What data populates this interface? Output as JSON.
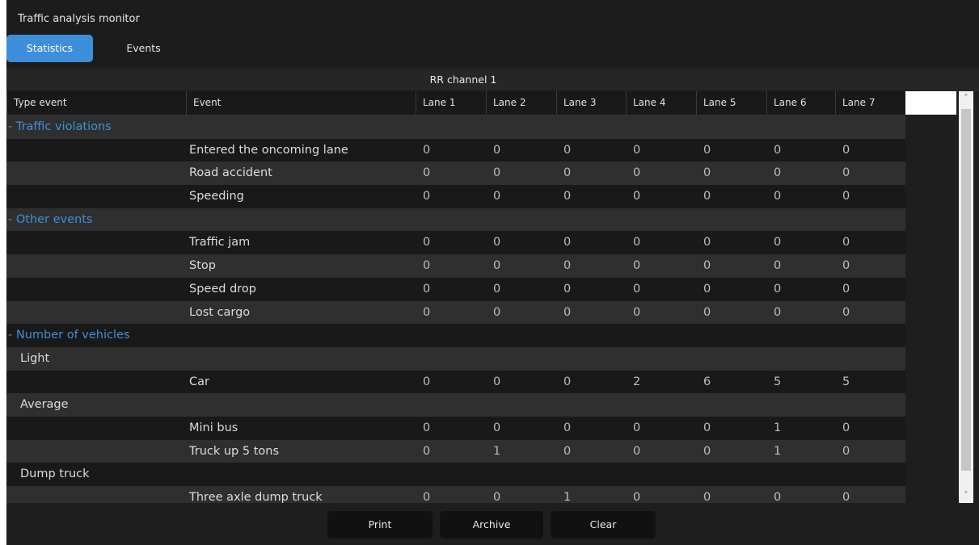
{
  "app": {
    "title": "Traffic analysis monitor"
  },
  "tabs": [
    {
      "label": "Statistics",
      "active": true
    },
    {
      "label": "Events",
      "active": false
    }
  ],
  "channel": "RR channel 1",
  "columns": [
    "Type event",
    "Event",
    "Lane 1",
    "Lane 2",
    "Lane 3",
    "Lane 4",
    "Lane 5",
    "Lane 6",
    "Lane 7"
  ],
  "rows": [
    {
      "kind": "group",
      "label": "- Traffic violations"
    },
    {
      "kind": "event",
      "event": "Entered the oncoming lane",
      "values": [
        "0",
        "0",
        "0",
        "0",
        "0",
        "0",
        "0"
      ]
    },
    {
      "kind": "event",
      "event": "Road accident",
      "values": [
        "0",
        "0",
        "0",
        "0",
        "0",
        "0",
        "0"
      ]
    },
    {
      "kind": "event",
      "event": "Speeding",
      "values": [
        "0",
        "0",
        "0",
        "0",
        "0",
        "0",
        "0"
      ]
    },
    {
      "kind": "group",
      "label": "- Other events"
    },
    {
      "kind": "event",
      "event": "Traffic jam",
      "values": [
        "0",
        "0",
        "0",
        "0",
        "0",
        "0",
        "0"
      ]
    },
    {
      "kind": "event",
      "event": "Stop",
      "values": [
        "0",
        "0",
        "0",
        "0",
        "0",
        "0",
        "0"
      ]
    },
    {
      "kind": "event",
      "event": "Speed drop",
      "values": [
        "0",
        "0",
        "0",
        "0",
        "0",
        "0",
        "0"
      ]
    },
    {
      "kind": "event",
      "event": "Lost cargo",
      "values": [
        "0",
        "0",
        "0",
        "0",
        "0",
        "0",
        "0"
      ]
    },
    {
      "kind": "group",
      "label": "- Number of vehicles"
    },
    {
      "kind": "type",
      "label": "Light"
    },
    {
      "kind": "event",
      "event": "Car",
      "values": [
        "0",
        "0",
        "0",
        "2",
        "6",
        "5",
        "5"
      ]
    },
    {
      "kind": "type",
      "label": "Average"
    },
    {
      "kind": "event",
      "event": "Mini bus",
      "values": [
        "0",
        "0",
        "0",
        "0",
        "0",
        "1",
        "0"
      ]
    },
    {
      "kind": "event",
      "event": "Truck up 5 tons",
      "values": [
        "0",
        "1",
        "0",
        "0",
        "0",
        "1",
        "0"
      ]
    },
    {
      "kind": "type",
      "label": "Dump truck"
    },
    {
      "kind": "event",
      "event": "Three axle dump truck",
      "values": [
        "0",
        "0",
        "1",
        "0",
        "0",
        "0",
        "0"
      ]
    }
  ],
  "buttons": {
    "print": "Print",
    "archive": "Archive",
    "clear": "Clear"
  },
  "icons": {
    "scroll_up": "chevron-up-icon",
    "scroll_down": "chevron-down-icon"
  },
  "colors": {
    "accent": "#3d8fdc",
    "background": "#1c1c1c"
  }
}
